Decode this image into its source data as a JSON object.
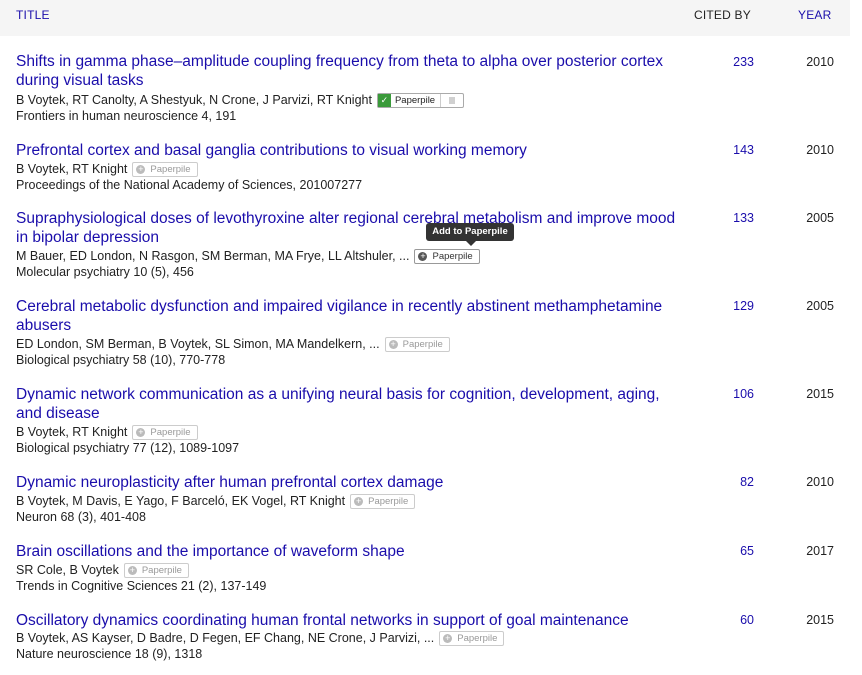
{
  "header": {
    "title": "TITLE",
    "cited_by": "CITED BY",
    "year": "YEAR"
  },
  "paperpile": {
    "label": "Paperpile",
    "tooltip": "Add to Paperpile"
  },
  "articles": [
    {
      "title": "Shifts in gamma phase–amplitude coupling frequency from theta to alpha over posterior cortex during visual tasks",
      "authors": "B Voytek, RT Canolty, A Shestyuk, N Crone, J Parvizi, RT Knight",
      "venue": "Frontiers in human neuroscience 4, 191",
      "cited": "233",
      "year": "2010"
    },
    {
      "title": "Prefrontal cortex and basal ganglia contributions to visual working memory",
      "authors": "B Voytek, RT Knight",
      "venue": "Proceedings of the National Academy of Sciences, 201007277",
      "cited": "143",
      "year": "2010"
    },
    {
      "title": "Supraphysiological doses of levothyroxine alter regional cerebral metabolism and improve mood in bipolar depression",
      "authors": "M Bauer, ED London, N Rasgon, SM Berman, MA Frye, LL Altshuler, ...",
      "venue": "Molecular psychiatry 10 (5), 456",
      "cited": "133",
      "year": "2005"
    },
    {
      "title": "Cerebral metabolic dysfunction and impaired vigilance in recently abstinent methamphetamine abusers",
      "authors": "ED London, SM Berman, B Voytek, SL Simon, MA Mandelkern, ...",
      "venue": "Biological psychiatry 58 (10), 770-778",
      "cited": "129",
      "year": "2005"
    },
    {
      "title": "Dynamic network communication as a unifying neural basis for cognition, development, aging, and disease",
      "authors": "B Voytek, RT Knight",
      "venue": "Biological psychiatry 77 (12), 1089-1097",
      "cited": "106",
      "year": "2015"
    },
    {
      "title": "Dynamic neuroplasticity after human prefrontal cortex damage",
      "authors": "B Voytek, M Davis, E Yago, F Barceló, EK Vogel, RT Knight",
      "venue": "Neuron 68 (3), 401-408",
      "cited": "82",
      "year": "2010"
    },
    {
      "title": "Brain oscillations and the importance of waveform shape",
      "authors": "SR Cole, B Voytek",
      "venue": "Trends in Cognitive Sciences 21 (2), 137-149",
      "cited": "65",
      "year": "2017"
    },
    {
      "title": "Oscillatory dynamics coordinating human frontal networks in support of goal maintenance",
      "authors": "B Voytek, AS Kayser, D Badre, D Fegen, EF Chang, NE Crone, J Parvizi, ...",
      "venue": "Nature neuroscience 18 (9), 1318",
      "cited": "60",
      "year": "2015"
    }
  ]
}
